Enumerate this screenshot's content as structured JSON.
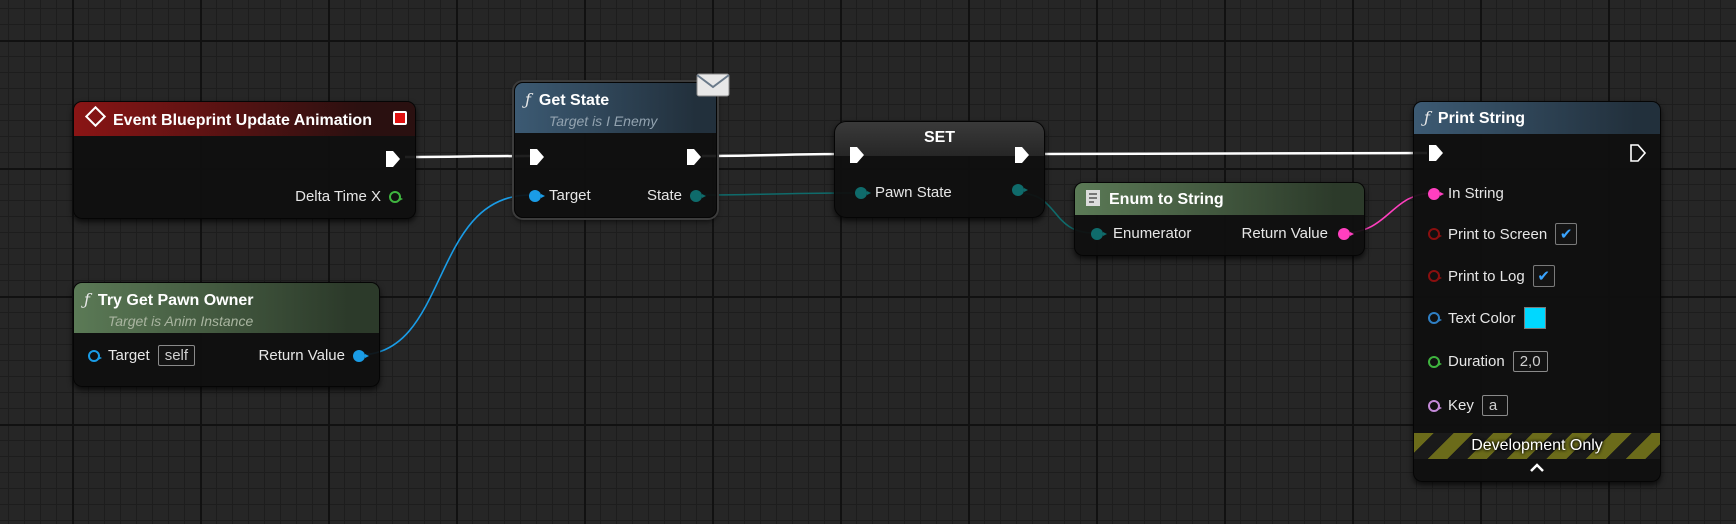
{
  "colors": {
    "exec": "#ffffff",
    "object": "#1a9ce6",
    "enum": "#0f6b6b",
    "string": "#ff3fbf",
    "bool": "#8a0f0f",
    "struct_color": "#2f7fc4",
    "float": "#3fb43f",
    "name": "#c48ad8",
    "event_header": "#8a1515",
    "function_header": "#3c5a73",
    "pure_header": "#5b7a56"
  },
  "nodes": {
    "event": {
      "title": "Event Blueprint Update Animation",
      "pin_delta": "Delta Time X"
    },
    "try_get": {
      "title": "Try Get Pawn Owner",
      "subtitle": "Target is Anim Instance",
      "pin_target": "Target",
      "target_value": "self",
      "pin_return": "Return Value"
    },
    "get_state": {
      "title": "Get State",
      "subtitle": "Target is I Enemy",
      "pin_target": "Target",
      "pin_state": "State"
    },
    "set": {
      "title": "SET",
      "pin_pawn_state": "Pawn State"
    },
    "enum_to_string": {
      "title": "Enum to String",
      "pin_enumerator": "Enumerator",
      "pin_return": "Return Value"
    },
    "print": {
      "title": "Print String",
      "pin_in_string": "In String",
      "pin_print_screen": "Print to Screen",
      "print_screen_checked": true,
      "pin_print_log": "Print to Log",
      "print_log_checked": true,
      "pin_text_color": "Text Color",
      "text_color_value": "#00d8ff",
      "pin_duration": "Duration",
      "duration_value": "2,0",
      "pin_key": "Key",
      "key_value": "a",
      "footer": "Development Only"
    }
  }
}
